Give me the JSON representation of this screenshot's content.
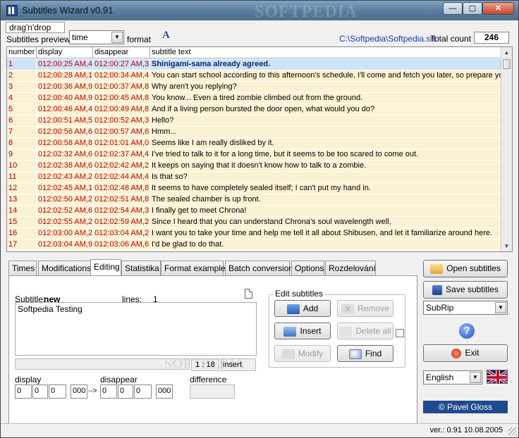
{
  "window": {
    "title": "Subtitles Wizard v0.91",
    "watermark": "SOFTPEDIA",
    "minimize": "—",
    "maximize": "▢",
    "close": "✕"
  },
  "toolbar": {
    "dragdrop": "drag'n'drop",
    "preview_label": "Subtitles preview:",
    "preview_value": "time",
    "format_label": "format",
    "font_icon_glyph": "A",
    "file_path": "C:\\Softpedia\\Softpedia.srt",
    "total_label": "Total count",
    "total_count": "246"
  },
  "table": {
    "columns": [
      "number",
      "display",
      "disappear",
      "subtitle text"
    ],
    "rows": [
      [
        "1",
        "012:00:25 AM,4",
        "012:00:27 AM,3",
        "Shinigami-sama already agreed."
      ],
      [
        "2",
        "012:00:28 AM,1",
        "012:00:34 AM,4",
        "You can start school according to this afternoon's schedule, I'll come and fetch you later, so prepare your"
      ],
      [
        "3",
        "012:00:36 AM,9",
        "012:00:37 AM,8",
        "Why aren't you replying?"
      ],
      [
        "4",
        "012:00:40 AM,9",
        "012:00:45 AM,8",
        "You know... Even a tired zombie climbed out from the ground."
      ],
      [
        "5",
        "012:00:46 AM,4",
        "012:00:49 AM,8",
        "And if a living person bursted the door open, what would you do?"
      ],
      [
        "6",
        "012:00:51 AM,5",
        "012:00:52 AM,3",
        "Hello?"
      ],
      [
        "7",
        "012:00:56 AM,6",
        "012:00:57 AM,6",
        "Hmm..."
      ],
      [
        "8",
        "012:00:58 AM,8",
        "012:01:01 AM,0",
        "Seems like I am really disliked by it."
      ],
      [
        "9",
        "012:02:32 AM,6",
        "012:02:37 AM,4",
        "I've tried to talk to it for a long time, but it seems to be too scared to come out."
      ],
      [
        "10",
        "012:02:38 AM,6",
        "012:02:42 AM,2",
        "It keeps on saying that it doesn't know how to talk to a zombie."
      ],
      [
        "11",
        "012:02:43 AM,2",
        "012:02:44 AM,4",
        "Is that so?"
      ],
      [
        "12",
        "012:02:45 AM,1",
        "012:02:48 AM,8",
        "It seems to have completely sealed itself; I can't put my hand in."
      ],
      [
        "13",
        "012:02:50 AM,2",
        "012:02:51 AM,8",
        "The sealed chamber is up front."
      ],
      [
        "14",
        "012:02:52 AM,6",
        "012:02:54 AM,3",
        "I finally get to meet Chrona!"
      ],
      [
        "15",
        "012:02:55 AM,2",
        "012:02:59 AM,2",
        "Since I heard that you can understand Chrona's soul wavelength well,"
      ],
      [
        "16",
        "012:03:00 AM,2",
        "012:03:04 AM,2",
        "I want you to take your time and help me tell it all about Shibusen, and let it familiarize around here."
      ],
      [
        "17",
        "012:03:04 AM,9",
        "012:03:06 AM,6",
        "I'd be glad to do that."
      ]
    ],
    "scroll_up": "▲",
    "scroll_down": "▼"
  },
  "tabs": [
    "Times",
    "Modifications",
    "Editing",
    "Statistika",
    "Format examples",
    "Batch conversion",
    "Options",
    "Rozdelování"
  ],
  "editing": {
    "subtitle_label": "Subtitle:",
    "subtitle_state": "new",
    "lines_label": "lines:",
    "lines_value": "1",
    "text": "Softpedia Testing",
    "position": "1 : 18",
    "mode": "insert",
    "display_label": "display",
    "disappear_label": "disappear",
    "difference_label": "difference",
    "display_fields": [
      "0",
      "0",
      "0",
      "000"
    ],
    "disappear_fields": [
      "0",
      "0",
      "0",
      "000"
    ],
    "separator": "-->",
    "edit_group_title": "Edit subtitles",
    "add": "Add",
    "remove": "Remove",
    "insert": "Insert",
    "delete_all": "Delete all",
    "modify": "Modify",
    "find": "Find"
  },
  "right_panel": {
    "open": "Open subtitles",
    "save": "Save subtitles",
    "format": "SubRip",
    "help": "?",
    "exit": "Exit",
    "language": "English",
    "credit": "© Pavel Gloss"
  },
  "status": {
    "version": "ver.: 0.91   10.08.2005"
  },
  "colors": {
    "row_bg": "#fbf2d3",
    "selected_row": "#cee3f7",
    "time_text": "#c40000",
    "path_text": "#1a3ba8"
  }
}
